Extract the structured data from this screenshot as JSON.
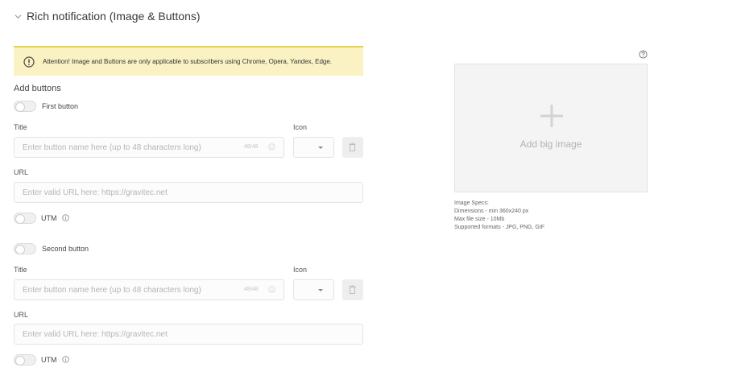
{
  "section": {
    "title": "Rich notification (Image & Buttons)"
  },
  "alert": {
    "text": "Attention! Image and Buttons are only applicable to subscribers using Chrome, Opera, Yandex, Edge."
  },
  "add_buttons_label": "Add buttons",
  "buttons": [
    {
      "toggle_label": "First button",
      "title_label": "Title",
      "title_placeholder": "Enter button name here (up to 48 characters long)",
      "counter": "48/48",
      "icon_label": "Icon",
      "url_label": "URL",
      "url_placeholder": "Enter valid URL here: https://gravitec.net",
      "utm_label": "UTM"
    },
    {
      "toggle_label": "Second button",
      "title_label": "Title",
      "title_placeholder": "Enter button name here (up to 48 characters long)",
      "counter": "48/48",
      "icon_label": "Icon",
      "url_label": "URL",
      "url_placeholder": "Enter valid URL here: https://gravitec.net",
      "utm_label": "UTM"
    }
  ],
  "image": {
    "dropzone_text": "Add big image",
    "specs": [
      "Image Specs:",
      "Dimensions - min 360x240 px",
      "Max file size - 10Mb",
      "Supported formats - JPG, PNG, GIF"
    ]
  },
  "colors": {
    "alert_bg": "#fbf2c4",
    "alert_border": "#e8d14a"
  }
}
